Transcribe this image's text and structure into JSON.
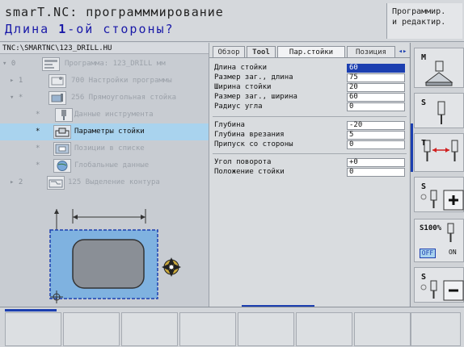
{
  "header": {
    "title_line1": "smarT.NC: программмирование",
    "title_line2_prefix": "Длина ",
    "title_line2_num": "1",
    "title_line2_suffix": "-ой стороны?",
    "mode_line1": "Программир.",
    "mode_line2": "и редактир."
  },
  "path": "TNC:\\SMARTNC\\123_DRILL.HU",
  "tree": [
    {
      "expander": "▾ 0",
      "label": "Программа: 123_DRILL мм"
    },
    {
      "expander": "▸ 1",
      "label": "700 Настройки программы"
    },
    {
      "expander": "▾ *",
      "label": "256 Прямоугольная стойка"
    },
    {
      "expander": "*",
      "label": "Данные инструмента"
    },
    {
      "expander": "*",
      "label": "Параметры стойки"
    },
    {
      "expander": "*",
      "label": "Позиции в списке"
    },
    {
      "expander": "*",
      "label": "Глобальные данные"
    },
    {
      "expander": "▸ 2",
      "label": "125 Выделение контура"
    }
  ],
  "tabs": [
    "Обзор",
    "Tool",
    "Пар.стойки",
    "Позиция"
  ],
  "fields_group1": [
    {
      "label": "Длина стойки",
      "value": "60"
    },
    {
      "label": "Размер заг., длина",
      "value": "75"
    },
    {
      "label": "Ширина стойки",
      "value": "20"
    },
    {
      "label": "Размер заг., ширина",
      "value": "60"
    },
    {
      "label": "Радиус угла",
      "value": "0"
    }
  ],
  "fields_group2": [
    {
      "label": "Глубина",
      "value": "-20"
    },
    {
      "label": "Глубина врезания",
      "value": "5"
    },
    {
      "label": "Припуск со стороны",
      "value": "0"
    }
  ],
  "fields_group3": [
    {
      "label": "Угол поворота",
      "value": "+0"
    },
    {
      "label": "Положение стойки",
      "value": "0"
    }
  ],
  "side_buttons": {
    "m_label": "M",
    "s_label": "S",
    "t_label": "T",
    "s_plus_label": "S",
    "feed_label": "S100%",
    "off_label": "OFF",
    "on_label": "ON",
    "s_minus_label": "S"
  },
  "colors": {
    "accent": "#1c3fb0",
    "selection": "#a9d3ee",
    "preview_fill": "#7fb2e0"
  }
}
